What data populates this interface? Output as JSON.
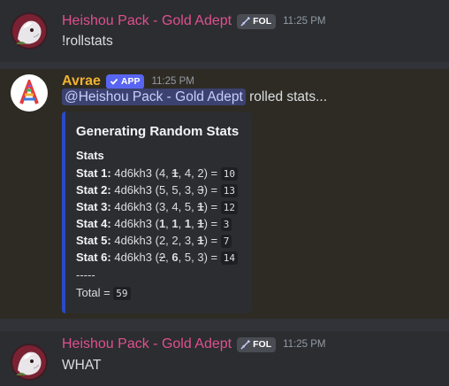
{
  "messages": [
    {
      "author": "Heishou Pack - Gold Adept",
      "tag": "FOL",
      "time": "11:25 PM",
      "text": "!rollstats"
    },
    {
      "author": "Avrae",
      "tag": "APP",
      "time": "11:25 PM",
      "mention": "@Heishou Pack - Gold Adept",
      "text_after": " rolled stats...",
      "embed": {
        "title": "Generating Random Stats",
        "field_name": "Stats",
        "stats": [
          {
            "label": "Stat 1:",
            "expr": "4d6kh3",
            "dice": [
              "4",
              "1",
              "4",
              "2"
            ],
            "kept": [
              true,
              false,
              true,
              true
            ],
            "total": "10"
          },
          {
            "label": "Stat 2:",
            "expr": "4d6kh3",
            "dice": [
              "5",
              "5",
              "3",
              "3"
            ],
            "kept": [
              true,
              true,
              true,
              false
            ],
            "total": "13"
          },
          {
            "label": "Stat 3:",
            "expr": "4d6kh3",
            "dice": [
              "3",
              "4",
              "5",
              "1"
            ],
            "kept": [
              true,
              true,
              true,
              false
            ],
            "total": "12"
          },
          {
            "label": "Stat 4:",
            "expr": "4d6kh3",
            "dice": [
              "1",
              "1",
              "1",
              "1"
            ],
            "kept": [
              true,
              true,
              true,
              false
            ],
            "total": "3"
          },
          {
            "label": "Stat 5:",
            "expr": "4d6kh3",
            "dice": [
              "2",
              "2",
              "3",
              "1"
            ],
            "kept": [
              true,
              true,
              true,
              false
            ],
            "total": "7"
          },
          {
            "label": "Stat 6:",
            "expr": "4d6kh3",
            "dice": [
              "2",
              "6",
              "5",
              "3"
            ],
            "kept": [
              false,
              true,
              true,
              true
            ],
            "total": "14"
          }
        ],
        "separator": "-----",
        "total_label": "Total =",
        "total_value": "59"
      }
    },
    {
      "author": "Heishou Pack - Gold Adept",
      "tag": "FOL",
      "time": "11:25 PM",
      "text": "WHAT"
    }
  ],
  "colors": {
    "author_pink": "#e0508f",
    "author_gold": "#f0b232",
    "app_badge": "#5865f2",
    "embed_border": "#2b49c9"
  },
  "icons": {
    "avatar": "white-wolf-avatar-icon",
    "bot_avatar": "rainbow-a-logo-icon",
    "role": "sword-icon",
    "verified": "checkmark-icon"
  }
}
